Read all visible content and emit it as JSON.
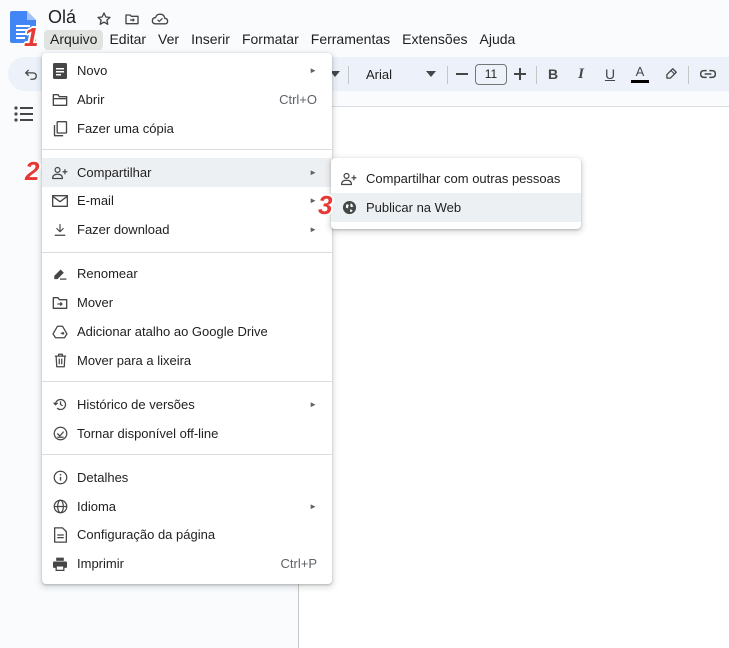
{
  "doc": {
    "title": "Olá"
  },
  "menubar": [
    "Arquivo",
    "Editar",
    "Ver",
    "Inserir",
    "Formatar",
    "Ferramentas",
    "Extensões",
    "Ajuda"
  ],
  "active_menu": "Arquivo",
  "toolbar": {
    "font_family": "Arial",
    "font_size": "11",
    "bold": "B",
    "italic": "I",
    "underline": "U",
    "text_color": "A"
  },
  "file_menu": {
    "items": [
      {
        "label": "Novo",
        "icon": "new-doc-icon",
        "arrow": true
      },
      {
        "label": "Abrir",
        "icon": "folder-icon",
        "shortcut": "Ctrl+O"
      },
      {
        "label": "Fazer uma cópia",
        "icon": "copy-icon"
      },
      {
        "label": "Compartilhar",
        "icon": "person-add-icon",
        "arrow": true,
        "highlighted": true
      },
      {
        "label": "E-mail",
        "icon": "mail-icon",
        "arrow": true
      },
      {
        "label": "Fazer download",
        "icon": "download-icon",
        "arrow": true
      },
      {
        "label": "Renomear",
        "icon": "rename-icon"
      },
      {
        "label": "Mover",
        "icon": "move-folder-icon"
      },
      {
        "label": "Adicionar atalho ao Google Drive",
        "icon": "drive-shortcut-icon"
      },
      {
        "label": "Mover para a lixeira",
        "icon": "trash-icon"
      },
      {
        "label": "Histórico de versões",
        "icon": "history-icon",
        "arrow": true
      },
      {
        "label": "Tornar disponível off-line",
        "icon": "offline-icon"
      },
      {
        "label": "Detalhes",
        "icon": "info-icon"
      },
      {
        "label": "Idioma",
        "icon": "globe-icon",
        "arrow": true
      },
      {
        "label": "Configuração da página",
        "icon": "page-setup-icon"
      },
      {
        "label": "Imprimir",
        "icon": "print-icon",
        "shortcut": "Ctrl+P"
      }
    ]
  },
  "share_submenu": {
    "items": [
      {
        "label": "Compartilhar com outras pessoas",
        "icon": "person-add-icon"
      },
      {
        "label": "Publicar na Web",
        "icon": "globe-icon",
        "highlighted": true
      }
    ]
  },
  "arrow_glyph": "►",
  "steps": [
    "1",
    "2",
    "3"
  ],
  "colors": {
    "menu_active": "#e1e3e1",
    "hover": "#edf0f2",
    "step_badge": "#e53935",
    "toolbar_bg": "#edf2fa",
    "doc_icon": "#4285f4"
  }
}
